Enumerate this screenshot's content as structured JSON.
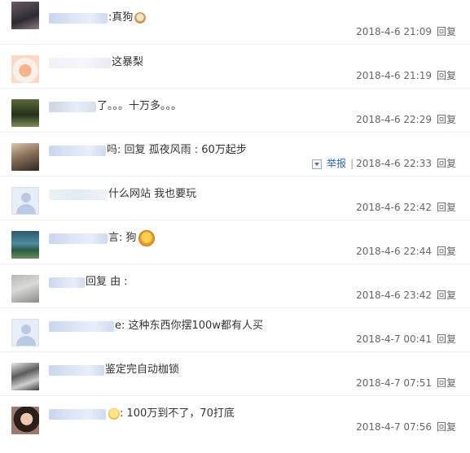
{
  "comments": [
    {
      "content": ":真狗",
      "time": "2018-4-6 21:09",
      "reply": "回复"
    },
    {
      "content": "这暴梨",
      "time": "2018-4-6 21:19",
      "reply": "回复"
    },
    {
      "content": "了。。。十万多。。。",
      "time": "2018-4-6 22:29",
      "reply": "回复"
    },
    {
      "content": "吗: 回复 孤夜风雨 : 60万起步",
      "time": "2018-4-6 22:33",
      "reply": "回复",
      "report": "举报"
    },
    {
      "content": "什么网站 我也要玩",
      "time": "2018-4-6 22:42",
      "reply": "回复"
    },
    {
      "content": "言: 狗",
      "time": "2018-4-6 22:44",
      "reply": "回复"
    },
    {
      "content": "回复 由 :",
      "time": "2018-4-6 23:42",
      "reply": "回复"
    },
    {
      "content": "e: 这种东西你摆100w都有人买",
      "time": "2018-4-7 00:41",
      "reply": "回复"
    },
    {
      "content": "鉴定完自动枷锁",
      "time": "2018-4-7 07:51",
      "reply": "回复"
    },
    {
      "content": ": 100万到不了，70打底",
      "time": "2018-4-7 07:56",
      "reply": "回复"
    }
  ]
}
